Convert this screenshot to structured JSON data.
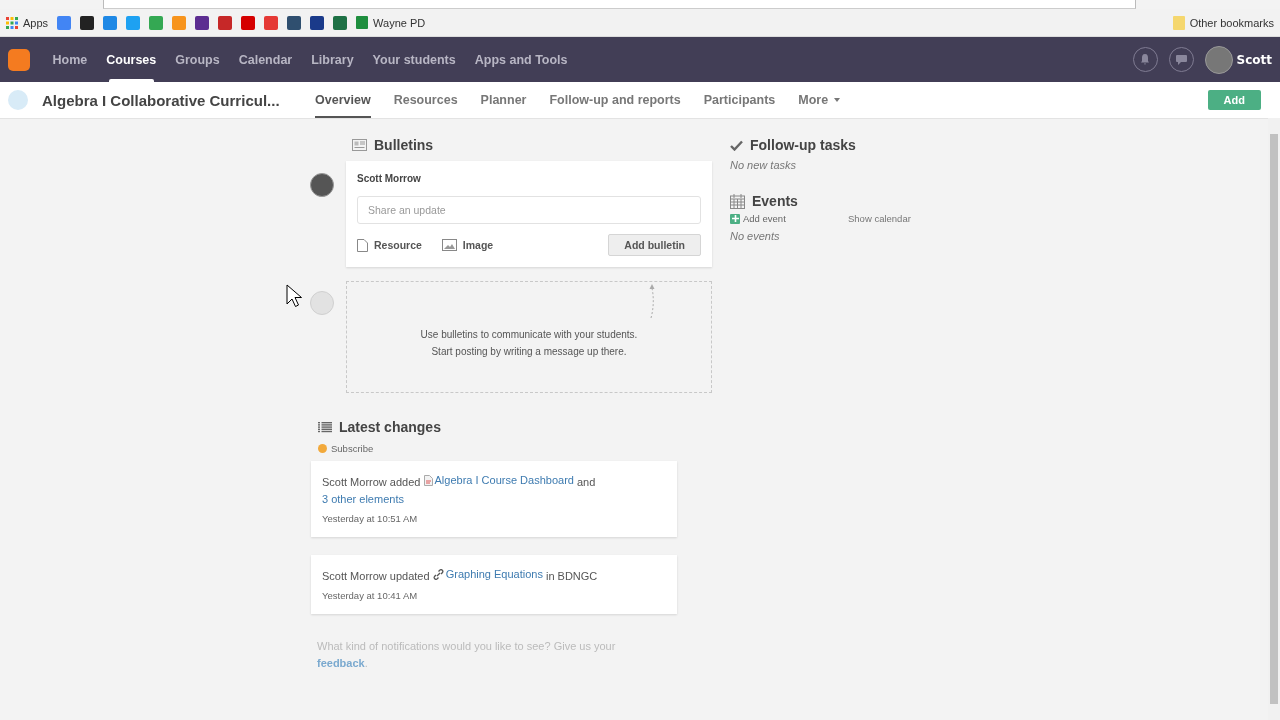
{
  "bookmarks_bar": {
    "apps_label": "Apps",
    "favicons": [
      {
        "color": "#4285f4"
      },
      {
        "color": "#222222"
      },
      {
        "color": "#1e88e5"
      },
      {
        "color": "#1da1f2"
      },
      {
        "color": "#34a853"
      },
      {
        "color": "#f7941d"
      },
      {
        "color": "#5c2d91"
      },
      {
        "color": "#c62828"
      },
      {
        "color": "#d50000"
      },
      {
        "color": "#e53935"
      },
      {
        "color": "#2f4f6f"
      },
      {
        "color": "#1a3a8a"
      },
      {
        "color": "#1e7145"
      }
    ],
    "wayne_label": "Wayne PD",
    "other_label": "Other bookmarks"
  },
  "top_nav": {
    "items": [
      {
        "label": "Home",
        "selected": false
      },
      {
        "label": "Courses",
        "selected": true
      },
      {
        "label": "Groups",
        "selected": false
      },
      {
        "label": "Calendar",
        "selected": false
      },
      {
        "label": "Library",
        "selected": false
      },
      {
        "label": "Your students",
        "selected": false
      },
      {
        "label": "Apps and Tools",
        "selected": false
      }
    ],
    "user_name": "Scott"
  },
  "course_bar": {
    "title": "Algebra I Collaborative Curricul...",
    "tabs": [
      {
        "label": "Overview",
        "selected": true,
        "dropdown": false
      },
      {
        "label": "Resources",
        "selected": false,
        "dropdown": false
      },
      {
        "label": "Planner",
        "selected": false,
        "dropdown": false
      },
      {
        "label": "Follow-up and reports",
        "selected": false,
        "dropdown": false
      },
      {
        "label": "Participants",
        "selected": false,
        "dropdown": false
      },
      {
        "label": "More",
        "selected": false,
        "dropdown": true
      }
    ],
    "add_button": "Add"
  },
  "bulletins": {
    "heading": "Bulletins",
    "author": "Scott Morrow",
    "placeholder": "Share an update",
    "resource_label": "Resource",
    "image_label": "Image",
    "add_button": "Add bulletin",
    "empty_lines": [
      "Use bulletins to communicate with your students.",
      "Start posting by writing a message up there."
    ]
  },
  "latest_changes": {
    "heading": "Latest changes",
    "subscribe": "Subscribe",
    "entries": [
      {
        "segments": [
          {
            "kind": "text",
            "text": "Scott Morrow added"
          },
          {
            "kind": "document_link",
            "text": "Algebra I Course Dashboard"
          },
          {
            "kind": "text",
            "text": "and"
          },
          {
            "kind": "link",
            "text": "3 other elements"
          }
        ],
        "time": "Yesterday at 10:51 AM"
      },
      {
        "segments": [
          {
            "kind": "text",
            "text": "Scott Morrow updated"
          },
          {
            "kind": "chain_link",
            "text": "Graphing Equations"
          },
          {
            "kind": "text",
            "text": "in BDNGC"
          }
        ],
        "time": "Yesterday at 10:41 AM"
      }
    ],
    "feedback_text": "What kind of notifications would you like to see? Give us your",
    "feedback_link": "feedback",
    "feedback_end": "."
  },
  "follow_up": {
    "heading": "Follow-up tasks",
    "empty": "No new tasks"
  },
  "events": {
    "heading": "Events",
    "add_event": "Add event",
    "show_calendar": "Show calendar",
    "empty": "No events"
  }
}
